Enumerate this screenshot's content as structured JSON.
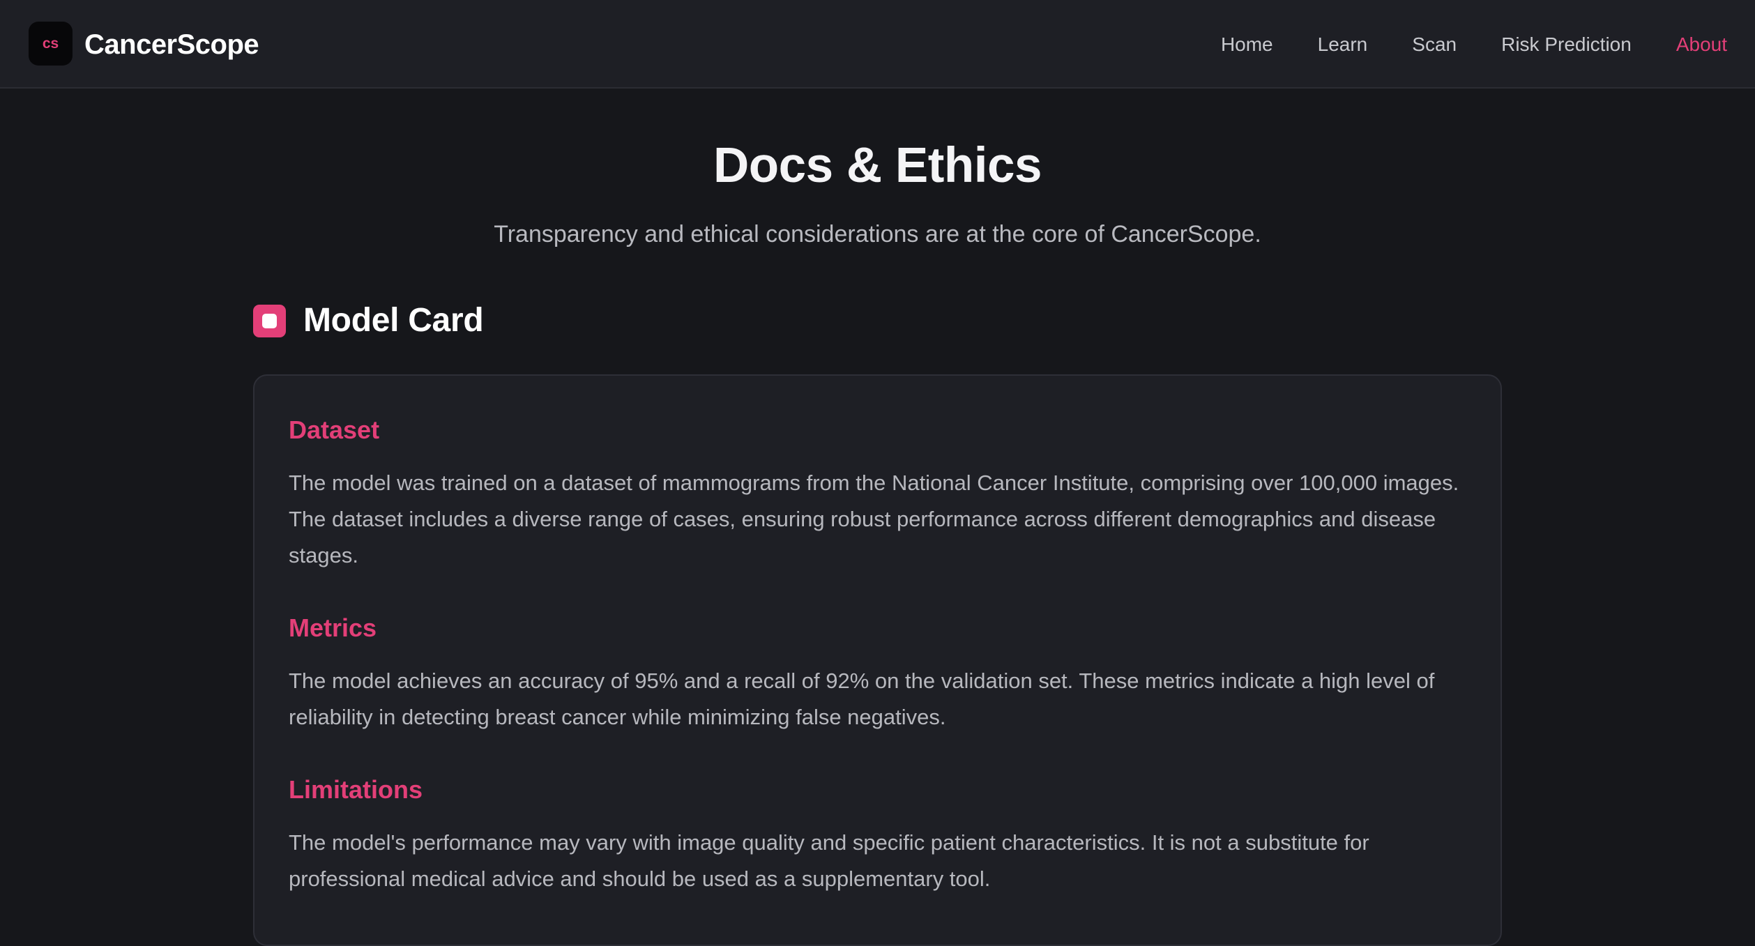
{
  "header": {
    "logo_text": "cs",
    "brand": "CancerScope",
    "nav": [
      {
        "label": "Home",
        "active": false
      },
      {
        "label": "Learn",
        "active": false
      },
      {
        "label": "Scan",
        "active": false
      },
      {
        "label": "Risk Prediction",
        "active": false
      },
      {
        "label": "About",
        "active": true
      }
    ]
  },
  "main": {
    "title": "Docs & Ethics",
    "subtitle": "Transparency and ethical considerations are at the core of CancerScope.",
    "section": {
      "icon": "square-icon",
      "title": "Model Card"
    },
    "card": {
      "sections": [
        {
          "heading": "Dataset",
          "text": "The model was trained on a dataset of mammograms from the National Cancer Institute, comprising over 100,000 images. The dataset includes a diverse range of cases, ensuring robust performance across different demographics and disease stages."
        },
        {
          "heading": "Metrics",
          "text": "The model achieves an accuracy of 95% and a recall of 92% on the validation set. These metrics indicate a high level of reliability in detecting breast cancer while minimizing false negatives."
        },
        {
          "heading": "Limitations",
          "text": "The model's performance may vary with image quality and specific patient characteristics. It is not a substitute for professional medical advice and should be used as a supplementary tool."
        }
      ]
    }
  },
  "colors": {
    "accent": "#e33f78",
    "background": "#16171b",
    "surface": "#1e1f25"
  }
}
